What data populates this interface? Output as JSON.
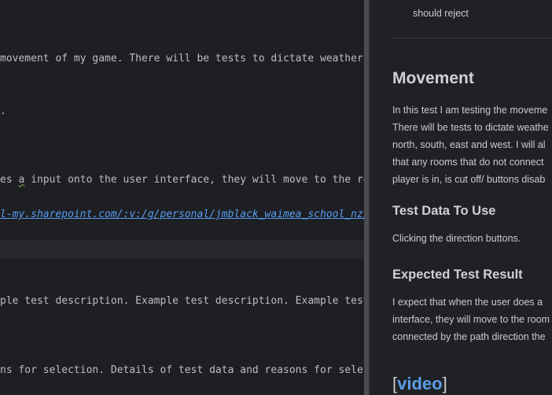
{
  "editor": {
    "lines": {
      "l1": "movement of my game. There will be tests to dictate weather",
      "l2": ".",
      "l3_a": "es ",
      "l3_a_wavy": "a",
      "l3_b": " input onto the user interface, they will move to the ro",
      "l4_link": "l-my.sharepoint.com/:v:/g/personal/jmblack_waimea_school_nz/",
      "l5": "ple test description. Example test description. Example test",
      "l6": "ns for selection. Details of test data and reasons for selec"
    }
  },
  "preview": {
    "top_item": "should reject",
    "heading_movement": "Movement",
    "movement_lines": [
      "In this test I am testing the moveme",
      "There will be tests to dictate weathe",
      "north, south, east and west. I will al",
      "that any rooms that do not connect",
      "player is in, is cut off/ buttons disab"
    ],
    "heading_test_data": "Test Data To Use",
    "test_data_text": "Clicking the direction buttons.",
    "heading_expected": "Expected Test Result",
    "expected_lines": [
      "I expect that when the user does a",
      "interface, they will move to the room",
      "connected by the path direction the"
    ],
    "video_open": "[",
    "video_label": "video",
    "video_close": "]"
  }
}
